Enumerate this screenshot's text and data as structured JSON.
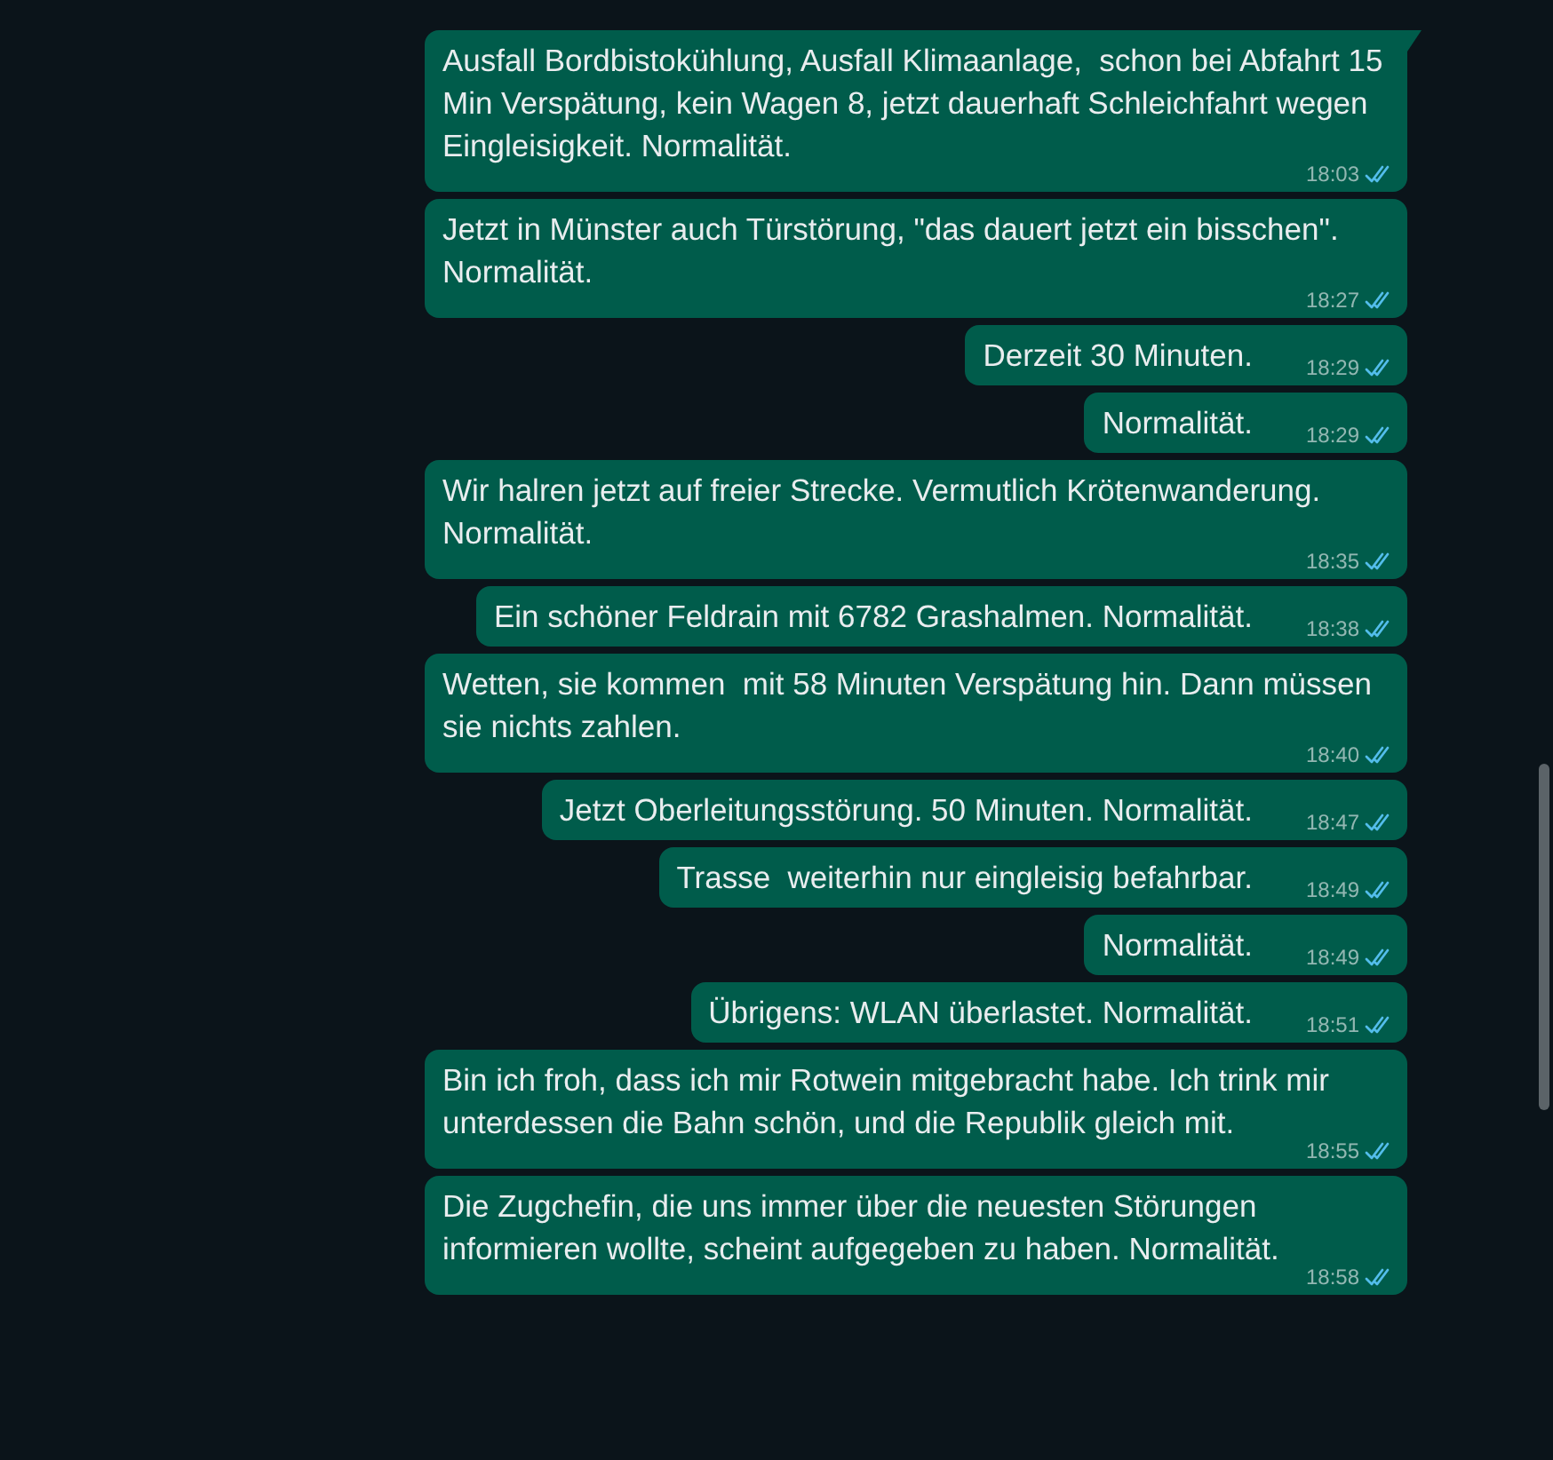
{
  "messages": [
    {
      "text": "Ausfall Bordbistokühlung, Ausfall Klimaanlage,  schon bei Abfahrt 15 Min Verspätung, kein Wagen 8, jetzt dauerhaft Schleichfahrt wegen Eingleisigkeit. Normalität.",
      "time": "18:03",
      "read": true,
      "tail": true
    },
    {
      "text": "Jetzt in Münster auch Türstörung, \"das dauert jetzt ein bisschen\". Normalität.",
      "time": "18:27",
      "read": true,
      "tail": false
    },
    {
      "text": "Derzeit 30 Minuten.",
      "time": "18:29",
      "read": true,
      "tail": false
    },
    {
      "text": "Normalität.",
      "time": "18:29",
      "read": true,
      "tail": false
    },
    {
      "text": "Wir halren jetzt auf freier Strecke. Vermutlich Krötenwanderung. Normalität.",
      "time": "18:35",
      "read": true,
      "tail": false
    },
    {
      "text": "Ein schöner Feldrain mit 6782 Grashalmen. Normalität.",
      "time": "18:38",
      "read": true,
      "tail": false
    },
    {
      "text": "Wetten, sie kommen  mit 58 Minuten Verspätung hin. Dann müssen sie nichts zahlen.",
      "time": "18:40",
      "read": true,
      "tail": false
    },
    {
      "text": "Jetzt Oberleitungsstörung. 50 Minuten. Normalität.",
      "time": "18:47",
      "read": true,
      "tail": false
    },
    {
      "text": "Trasse  weiterhin nur eingleisig befahrbar.",
      "time": "18:49",
      "read": true,
      "tail": false
    },
    {
      "text": "Normalität.",
      "time": "18:49",
      "read": true,
      "tail": false
    },
    {
      "text": "Übrigens: WLAN überlastet. Normalität.",
      "time": "18:51",
      "read": true,
      "tail": false
    },
    {
      "text": "Bin ich froh, dass ich mir Rotwein mitgebracht habe. Ich trink mir unterdessen die Bahn schön, und die Republik gleich mit.",
      "time": "18:55",
      "read": true,
      "tail": false
    },
    {
      "text": "Die Zugchefin, die uns immer über die neuesten Störungen informieren wollte, scheint aufgegeben zu haben. Normalität.",
      "time": "18:58",
      "read": true,
      "tail": false
    }
  ]
}
